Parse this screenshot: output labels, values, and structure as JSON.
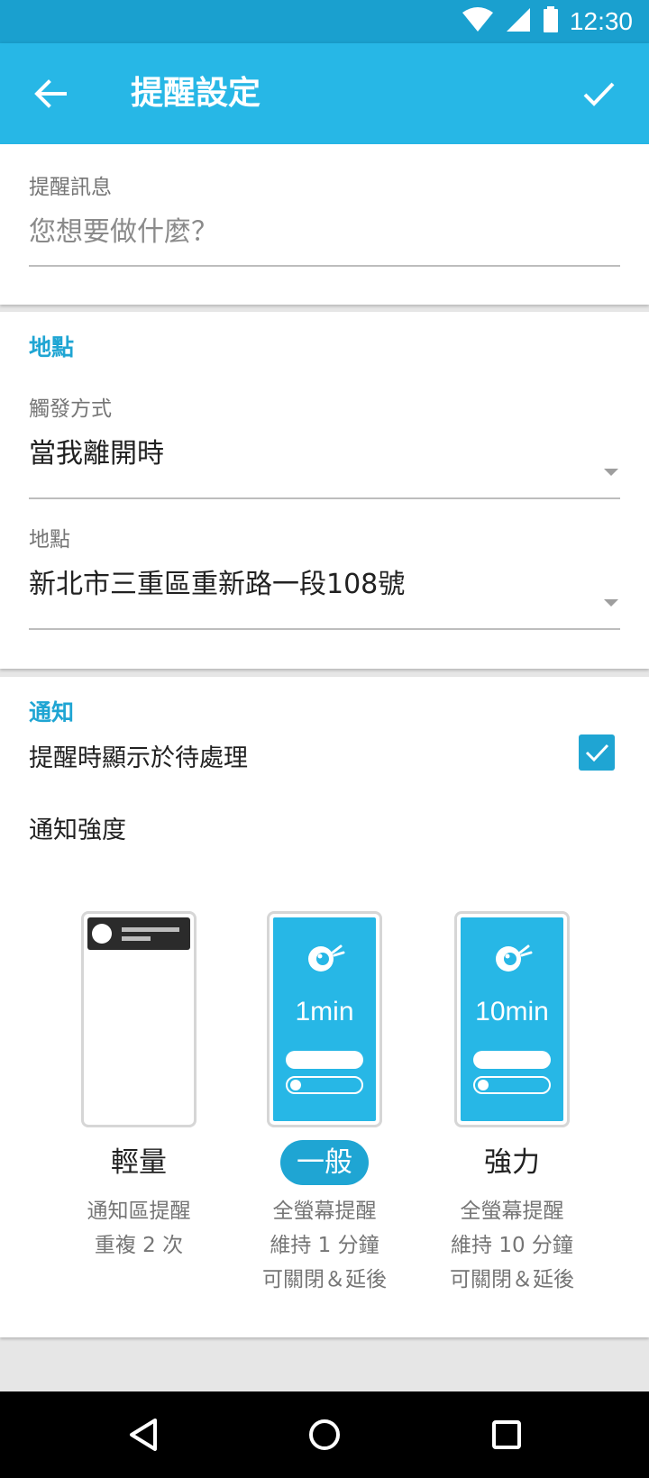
{
  "status_bar": {
    "time": "12:30",
    "icons": [
      "wifi-icon",
      "signal-icon",
      "battery-icon"
    ]
  },
  "app_bar": {
    "title": "提醒設定",
    "back_icon": "arrow-left-icon",
    "confirm_icon": "check-icon",
    "color": "#27b7e6"
  },
  "message": {
    "label": "提醒訊息",
    "placeholder": "您想要做什麼？"
  },
  "location": {
    "section_title": "地點",
    "trigger": {
      "label": "觸發方式",
      "value": "當我離開時"
    },
    "place": {
      "label": "地點",
      "value": "新北市三重區重新路一段108號"
    }
  },
  "notify": {
    "section_title": "通知",
    "show_in_todo": {
      "label": "提醒時顯示於待處理",
      "checked": true
    },
    "intensity_label": "通知強度",
    "options": [
      {
        "name": "輕量",
        "desc": [
          "通知區提醒",
          "重複 2 次"
        ],
        "selected": false
      },
      {
        "name": "一般",
        "duration": "1min",
        "desc": [
          "全螢幕提醒",
          "維持 1 分鐘",
          "可關閉＆延後"
        ],
        "selected": true
      },
      {
        "name": "強力",
        "duration": "10min",
        "desc": [
          "全螢幕提醒",
          "維持 10 分鐘",
          "可關閉＆延後"
        ],
        "selected": false
      }
    ]
  },
  "nav_bar": {
    "icons": [
      "back-triangle-icon",
      "home-circle-icon",
      "recents-square-icon"
    ]
  },
  "colors": {
    "accent": "#1fa5d3",
    "status_bar": "#1aa0cf"
  }
}
